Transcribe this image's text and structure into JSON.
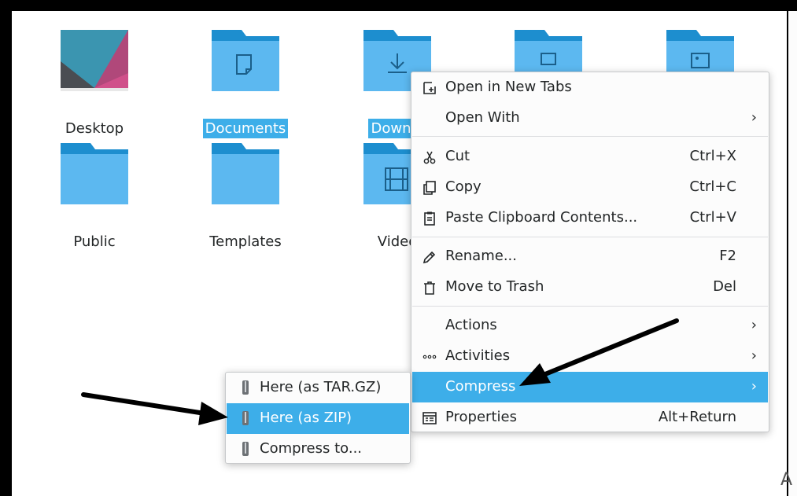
{
  "files": [
    {
      "name": "Desktop"
    },
    {
      "name": "Documents"
    },
    {
      "name": "Downlo"
    },
    {
      "name": ""
    },
    {
      "name": ""
    },
    {
      "name": "Public"
    },
    {
      "name": "Templates"
    },
    {
      "name": "Video"
    }
  ],
  "context_menu": {
    "items": [
      {
        "label": "Open in New Tabs",
        "icon": "open-new-tab-icon"
      },
      {
        "label": "Open With",
        "icon": "",
        "submenu": true
      },
      {
        "label": "Cut",
        "icon": "scissors-icon",
        "shortcut": "Ctrl+X"
      },
      {
        "label": "Copy",
        "icon": "copy-icon",
        "shortcut": "Ctrl+C"
      },
      {
        "label": "Paste Clipboard Contents...",
        "icon": "paste-icon",
        "shortcut": "Ctrl+V"
      },
      {
        "label": "Rename...",
        "icon": "pencil-icon",
        "shortcut": "F2"
      },
      {
        "label": "Move to Trash",
        "icon": "trash-icon",
        "shortcut": "Del"
      },
      {
        "label": "Actions",
        "icon": "",
        "submenu": true
      },
      {
        "label": "Activities",
        "icon": "activities-icon",
        "submenu": true
      },
      {
        "label": "Compress",
        "icon": "",
        "submenu": true,
        "highlighted": true
      },
      {
        "label": "Properties",
        "icon": "properties-icon",
        "shortcut": "Alt+Return"
      }
    ]
  },
  "compress_submenu": {
    "items": [
      {
        "label": "Here (as TAR.GZ)",
        "icon": "archive-icon"
      },
      {
        "label": "Here (as ZIP)",
        "icon": "archive-icon",
        "highlighted": true
      },
      {
        "label": "Compress to...",
        "icon": "archive-icon"
      }
    ]
  },
  "chevron": "›",
  "corner_glyph": "A",
  "colors": {
    "accent": "#3daee9",
    "folder_body": "#5cb8f0",
    "folder_tab": "#1d8ecf",
    "text": "#232627"
  }
}
